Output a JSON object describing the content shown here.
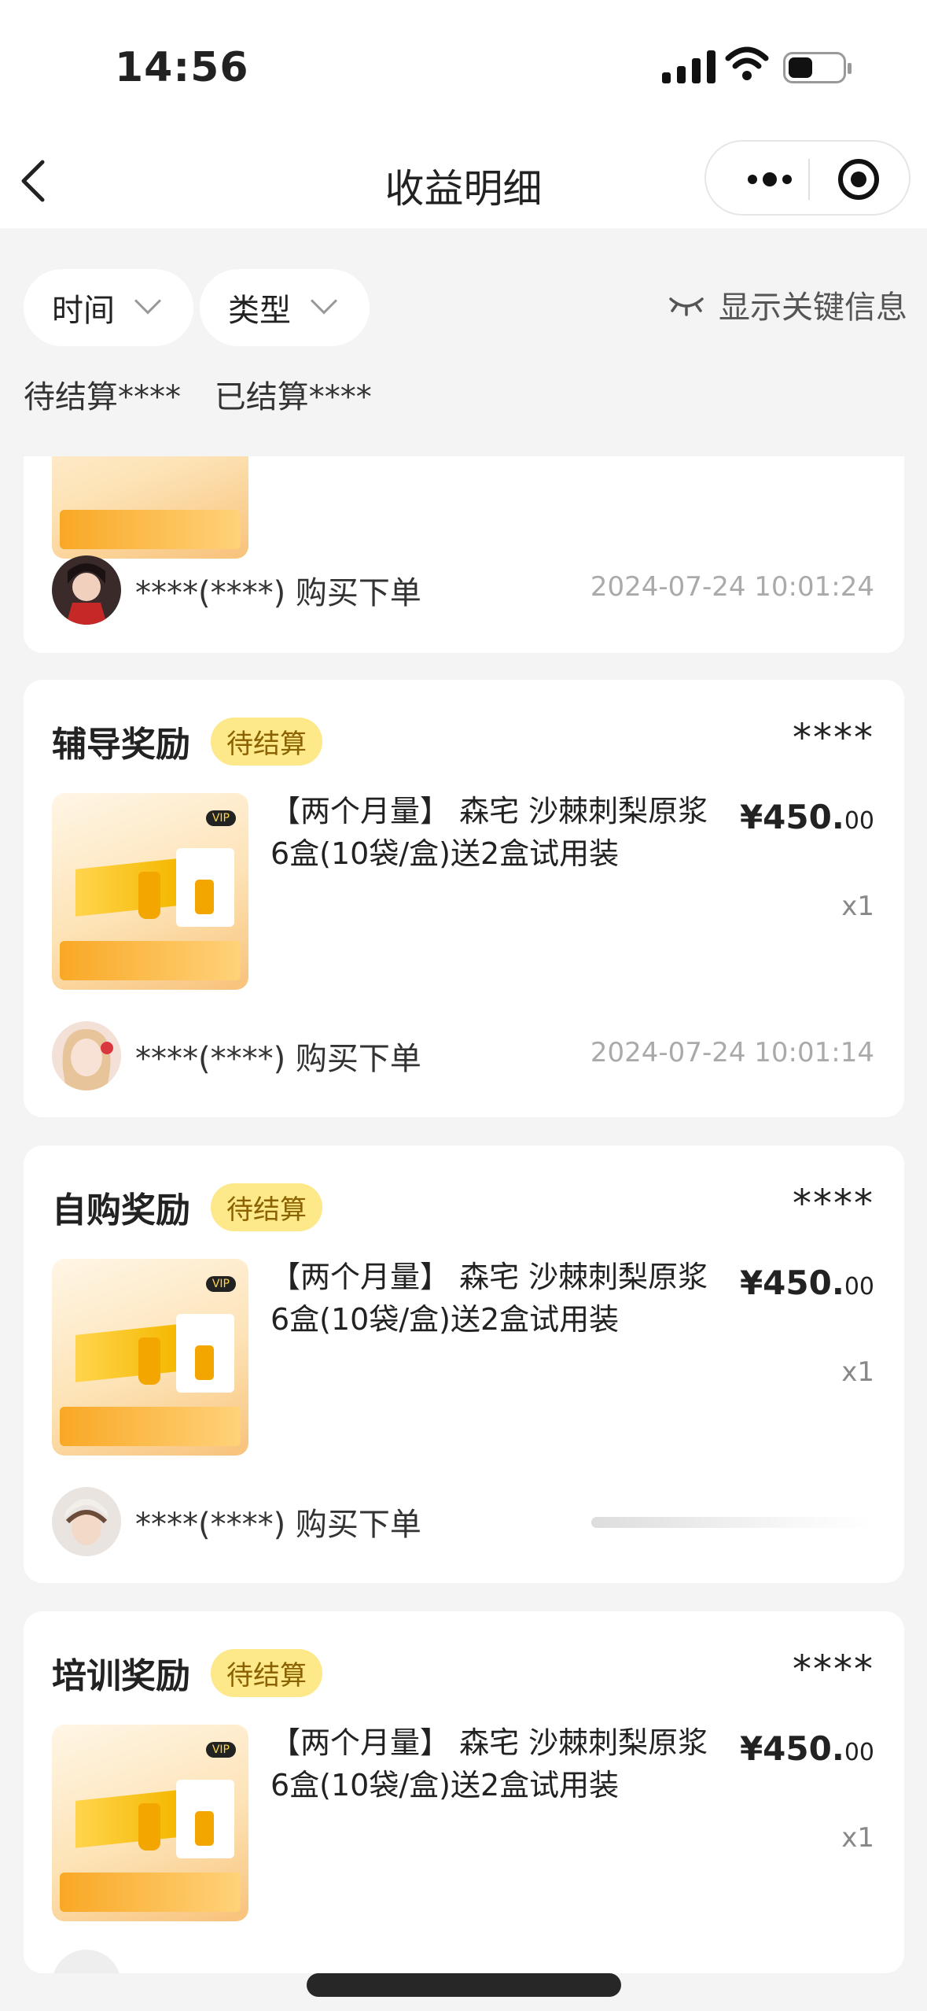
{
  "status_bar": {
    "time": "14:56"
  },
  "nav": {
    "title": "收益明细"
  },
  "filters": {
    "time": "时间",
    "type": "类型"
  },
  "toggle": {
    "label": "显示关键信息"
  },
  "summary": {
    "pending": "待结算****",
    "settled": "已结算****"
  },
  "cards": [
    {
      "buyer": "****(****) 购买下单",
      "timestamp": "2024-07-24 10:01:24"
    },
    {
      "title": "辅导奖励",
      "badge": "待结算",
      "amount": "****",
      "product": "【两个月量】 森宅 沙棘刺梨原浆6盒(10袋/盒)送2盒试用装",
      "price_main": "¥450.",
      "price_cents": "00",
      "qty": "x1",
      "buyer": "****(****) 购买下单",
      "timestamp": "2024-07-24 10:01:14"
    },
    {
      "title": "自购奖励",
      "badge": "待结算",
      "amount": "****",
      "product": "【两个月量】 森宅 沙棘刺梨原浆6盒(10袋/盒)送2盒试用装",
      "price_main": "¥450.",
      "price_cents": "00",
      "qty": "x1",
      "buyer": "****(****) 购买下单"
    },
    {
      "title": "培训奖励",
      "badge": "待结算",
      "amount": "****",
      "product": "【两个月量】 森宅 沙棘刺梨原浆6盒(10袋/盒)送2盒试用装",
      "price_main": "¥450.",
      "price_cents": "00",
      "qty": "x1"
    }
  ],
  "product_image": {
    "vip_tag": "VIP"
  },
  "colors": {
    "badge_bg": "#fde98a",
    "badge_text": "#8a6200",
    "page_bg": "#f4f4f4"
  }
}
